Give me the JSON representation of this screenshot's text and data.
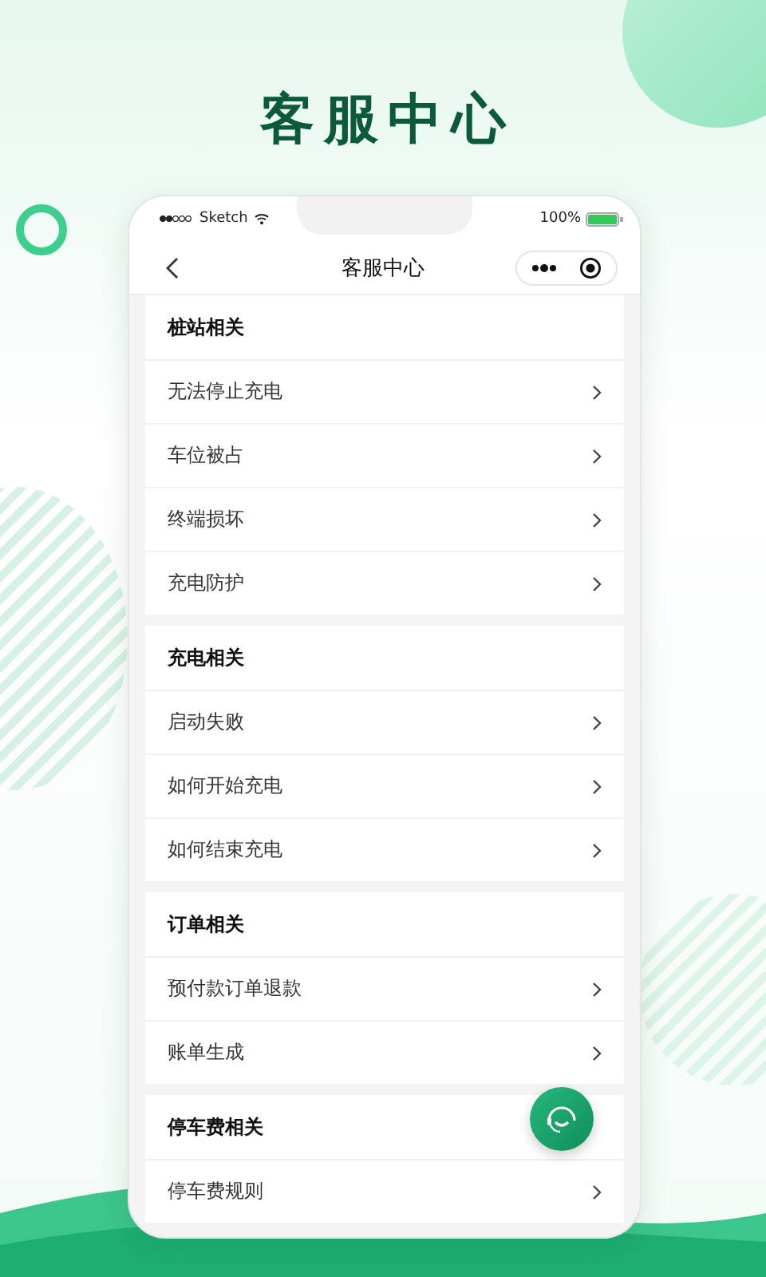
{
  "headline": "客服中心",
  "status_bar": {
    "carrier": "Sketch",
    "battery": "100%"
  },
  "nav": {
    "title": "客服中心"
  },
  "sections": [
    {
      "title": "桩站相关",
      "items": [
        {
          "label": "无法停止充电"
        },
        {
          "label": "车位被占"
        },
        {
          "label": "终端损坏"
        },
        {
          "label": "充电防护"
        }
      ]
    },
    {
      "title": "充电相关",
      "items": [
        {
          "label": "启动失败"
        },
        {
          "label": "如何开始充电"
        },
        {
          "label": "如何结束充电"
        }
      ]
    },
    {
      "title": "订单相关",
      "items": [
        {
          "label": "预付款订单退款"
        },
        {
          "label": "账单生成"
        }
      ]
    },
    {
      "title": "停车费相关",
      "items": [
        {
          "label": "停车费规则"
        }
      ]
    }
  ]
}
